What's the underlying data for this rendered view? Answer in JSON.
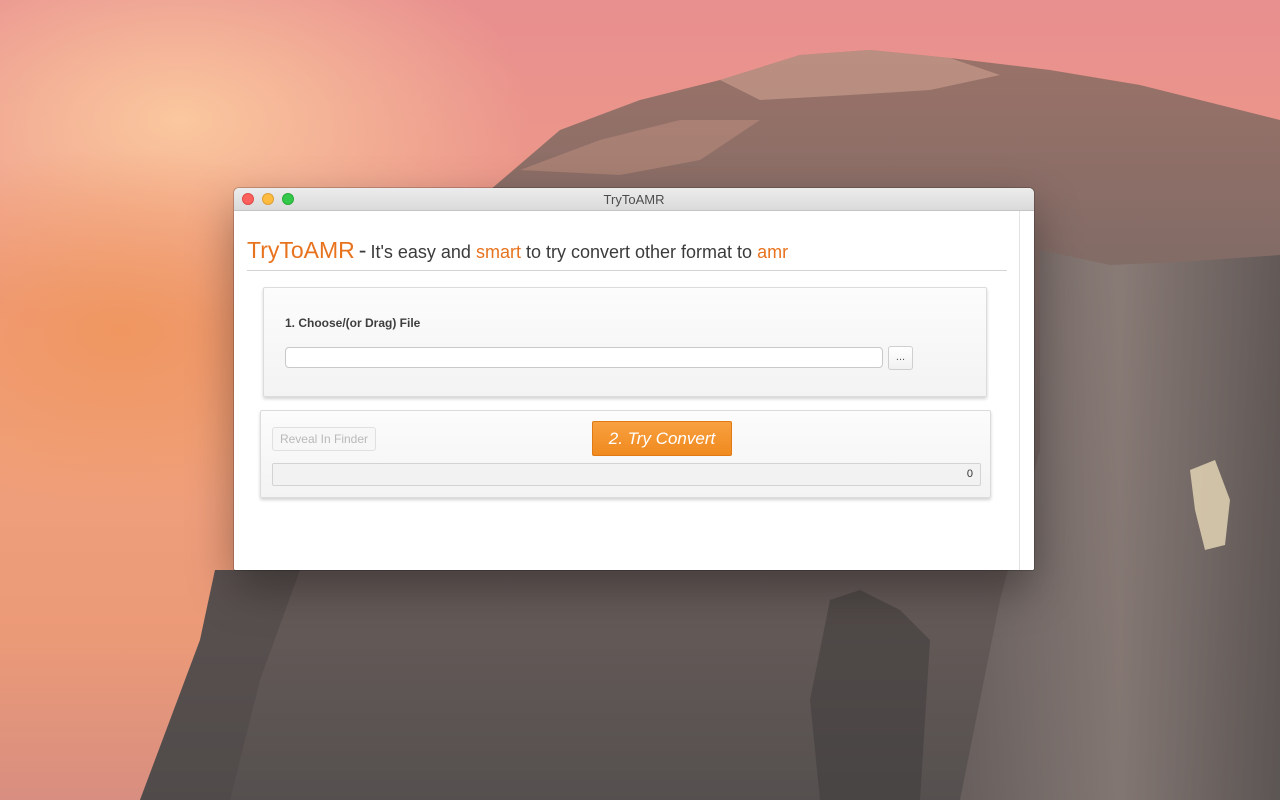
{
  "window": {
    "title": "TryToAMR"
  },
  "header": {
    "brand": "TryToAMR",
    "separator": "-",
    "text_1": "It's easy and",
    "accent_1": "smart",
    "text_2": "to try convert other format to",
    "accent_2": "amr"
  },
  "choose_panel": {
    "label": "1. Choose/(or Drag) File",
    "file_path_value": "",
    "browse_label": "..."
  },
  "convert_panel": {
    "reveal_label": "Reveal In Finder",
    "reveal_enabled": false,
    "convert_label": "2. Try Convert",
    "progress_fraction": 0,
    "progress_count": "0"
  },
  "colors": {
    "accent": "#e8731e",
    "button_orange": "#f08a1f"
  }
}
